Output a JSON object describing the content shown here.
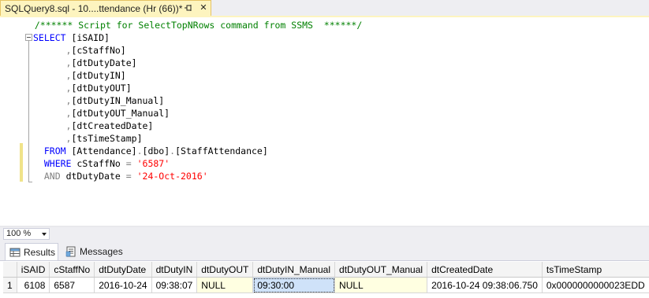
{
  "tab": {
    "title": "SQLQuery8.sql - 10....ttendance (Hr (66))*",
    "pin_icon": "pin-icon",
    "close_glyph": "✕"
  },
  "editor": {
    "lines": [
      {
        "indent": "  ",
        "parts": [
          {
            "t": "/****** Script for SelectTopNRows command from SSMS  ******/",
            "c": "comment"
          }
        ]
      },
      {
        "indent": "",
        "parts": [
          {
            "t": "SELECT",
            "c": "kw"
          },
          {
            "t": " [iSAID]",
            "c": "txt"
          }
        ]
      },
      {
        "indent": "      ",
        "parts": [
          {
            "t": ",",
            "c": "punct"
          },
          {
            "t": "[cStaffNo]",
            "c": "txt"
          }
        ]
      },
      {
        "indent": "      ",
        "parts": [
          {
            "t": ",",
            "c": "punct"
          },
          {
            "t": "[dtDutyDate]",
            "c": "txt"
          }
        ]
      },
      {
        "indent": "      ",
        "parts": [
          {
            "t": ",",
            "c": "punct"
          },
          {
            "t": "[dtDutyIN]",
            "c": "txt"
          }
        ]
      },
      {
        "indent": "      ",
        "parts": [
          {
            "t": ",",
            "c": "punct"
          },
          {
            "t": "[dtDutyOUT]",
            "c": "txt"
          }
        ]
      },
      {
        "indent": "      ",
        "parts": [
          {
            "t": ",",
            "c": "punct"
          },
          {
            "t": "[dtDutyIN_Manual]",
            "c": "txt"
          }
        ]
      },
      {
        "indent": "      ",
        "parts": [
          {
            "t": ",",
            "c": "punct"
          },
          {
            "t": "[dtDutyOUT_Manual]",
            "c": "txt"
          }
        ]
      },
      {
        "indent": "      ",
        "parts": [
          {
            "t": ",",
            "c": "punct"
          },
          {
            "t": "[dtCreatedDate]",
            "c": "txt"
          }
        ]
      },
      {
        "indent": "      ",
        "parts": [
          {
            "t": ",",
            "c": "punct"
          },
          {
            "t": "[tsTimeStamp]",
            "c": "txt"
          }
        ]
      },
      {
        "indent": "  ",
        "parts": [
          {
            "t": "FROM",
            "c": "kw"
          },
          {
            "t": " [Attendance]",
            "c": "txt"
          },
          {
            "t": ".",
            "c": "punct"
          },
          {
            "t": "[dbo]",
            "c": "txt"
          },
          {
            "t": ".",
            "c": "punct"
          },
          {
            "t": "[StaffAttendance]",
            "c": "txt"
          }
        ]
      },
      {
        "indent": "  ",
        "parts": [
          {
            "t": "WHERE",
            "c": "kw"
          },
          {
            "t": " cStaffNo ",
            "c": "txt"
          },
          {
            "t": "=",
            "c": "punct"
          },
          {
            "t": " ",
            "c": "txt"
          },
          {
            "t": "'6587'",
            "c": "str"
          }
        ]
      },
      {
        "indent": "  ",
        "parts": [
          {
            "t": "AND",
            "c": "punct"
          },
          {
            "t": " dtDutyDate ",
            "c": "txt"
          },
          {
            "t": "=",
            "c": "punct"
          },
          {
            "t": " ",
            "c": "txt"
          },
          {
            "t": "'24-Oct-2016'",
            "c": "str"
          }
        ]
      }
    ]
  },
  "zoom": {
    "value": "100 %"
  },
  "results": {
    "tabs": [
      {
        "label": "Results",
        "icon": "grid-icon"
      },
      {
        "label": "Messages",
        "icon": "messages-icon"
      }
    ],
    "columns": [
      "iSAID",
      "cStaffNo",
      "dtDutyDate",
      "dtDutyIN",
      "dtDutyOUT",
      "dtDutyIN_Manual",
      "dtDutyOUT_Manual",
      "dtCreatedDate",
      "tsTimeStamp"
    ],
    "rows": [
      {
        "num": "1",
        "cells": [
          "6108",
          "6587",
          "2016-10-24",
          "09:38:07",
          "NULL",
          "09:30:00",
          "NULL",
          "2016-10-24 09:38:06.750",
          "0x0000000000023EDD"
        ]
      }
    ]
  },
  "colors": {
    "keyword": "#0000ff",
    "comment": "#008000",
    "string": "#ff0000",
    "punct": "#808080",
    "tab_active": "#fdf4bf",
    "null_cell": "#ffffe1",
    "selected_cell": "#cfe2f9"
  }
}
